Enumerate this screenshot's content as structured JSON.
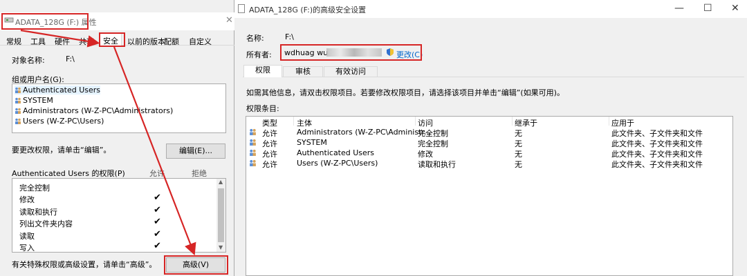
{
  "props": {
    "title": "ADATA_128G (F:) 属性",
    "tabs": [
      "常规",
      "工具",
      "硬件",
      "共享",
      "安全",
      "以前的版本",
      "配额",
      "自定义"
    ],
    "object_label": "对象名称:",
    "object_value": "F:\\",
    "group_label": "组或用户名(G):",
    "users": [
      "Authenticated Users",
      "SYSTEM",
      "Administrators (W-Z-PC\\Administrators)",
      "Users (W-Z-PC\\Users)"
    ],
    "edit_hint": "要更改权限，请单击“编辑”。",
    "edit_button": "编辑(E)...",
    "perm_header": "Authenticated Users 的权限(P)",
    "allow_label": "允许",
    "deny_label": "拒绝",
    "perms": [
      "完全控制",
      "修改",
      "读取和执行",
      "列出文件夹内容",
      "读取",
      "写入"
    ],
    "checks": [
      false,
      true,
      true,
      true,
      true,
      true
    ],
    "advanced_hint": "有关特殊权限或高级设置，请单击“高级”。",
    "advanced_button": "高级(V)"
  },
  "adv": {
    "title": "ADATA_128G (F:)的高级安全设置",
    "name_label": "名称:",
    "name_value": "F:\\",
    "owner_label": "所有者:",
    "owner_value": "wdhuag wu",
    "change_link": "更改(C)",
    "tabs": [
      "权限",
      "审核",
      "有效访问"
    ],
    "info_text": "如需其他信息，请双击权限项目。若要修改权限项目，请选择该项目并单击“编辑”(如果可用)。",
    "entries_label": "权限条目:",
    "columns": [
      "类型",
      "主体",
      "访问",
      "继承于",
      "应用于"
    ],
    "rows": [
      {
        "type": "允许",
        "principal": "Administrators (W-Z-PC\\Administr...",
        "access": "完全控制",
        "inherit": "无",
        "apply": "此文件夹、子文件夹和文件"
      },
      {
        "type": "允许",
        "principal": "SYSTEM",
        "access": "完全控制",
        "inherit": "无",
        "apply": "此文件夹、子文件夹和文件"
      },
      {
        "type": "允许",
        "principal": "Authenticated Users",
        "access": "修改",
        "inherit": "无",
        "apply": "此文件夹、子文件夹和文件"
      },
      {
        "type": "允许",
        "principal": "Users (W-Z-PC\\Users)",
        "access": "读取和执行",
        "inherit": "无",
        "apply": "此文件夹、子文件夹和文件"
      }
    ]
  },
  "colors": {
    "annotation_red": "#d62525",
    "link_blue": "#0066cc",
    "desktop_teal": "#1a8a7a"
  },
  "icons": [
    "drive-icon",
    "users-icon",
    "shield-icon",
    "minimize-icon",
    "maximize-icon",
    "close-icon",
    "checkmark-icon",
    "scroll-down-icon"
  ]
}
